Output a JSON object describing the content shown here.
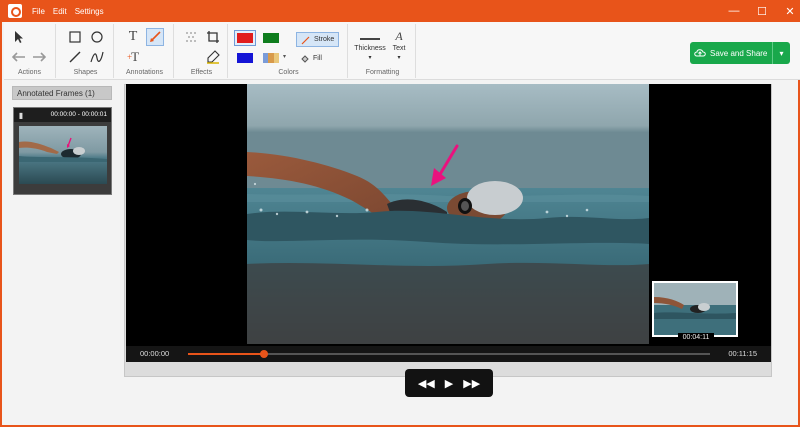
{
  "window": {
    "menu": [
      "File",
      "Edit",
      "Settings"
    ],
    "controls": {
      "minimize": "—",
      "maximize": "☐",
      "close": "✕"
    }
  },
  "ribbon": {
    "groups": {
      "actions": "Actions",
      "shapes": "Shapes",
      "annotations": "Annotations",
      "effects": "Effects",
      "colors": "Colors",
      "formatting": "Formatting"
    },
    "colors": {
      "red": "#e11d1d",
      "green": "#0f7d1e",
      "blue": "#1515d6",
      "multi": "#d89a4a"
    },
    "stroke_label": "Stroke",
    "fill_label": "Fill",
    "thickness_label": "Thickness",
    "text_label": "Text"
  },
  "save_button": {
    "label": "Save and Share"
  },
  "left_panel": {
    "header": "Annotated Frames (1)",
    "frame_time": "00:00:00 - 00:00:01"
  },
  "player": {
    "current_time": "00:00:00",
    "duration": "00:11:15",
    "progress": 0.146,
    "pip_time": "00:04:11"
  },
  "accent": "#e8541a",
  "save_color": "#19a84b"
}
